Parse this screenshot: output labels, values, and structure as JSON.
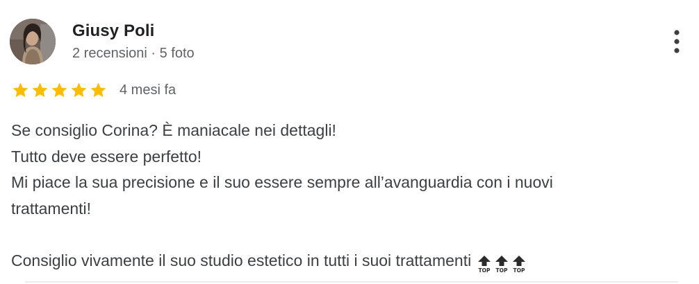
{
  "review": {
    "author": {
      "name": "Giusy Poli",
      "meta": "2 recensioni · 5 foto",
      "avatar_icon": "profile-photo"
    },
    "rating": {
      "stars": 5,
      "max": 5,
      "star_color": "#fbbc04",
      "date": "4 mesi fa"
    },
    "text": {
      "line1": "Se consiglio Corina? È maniacale nei dettagli!",
      "line2": "Tutto deve essere perfetto!",
      "line3": "Mi piace la sua precisione e il suo essere sempre all’avanguardia con i nuovi",
      "line4": "trattamenti!",
      "line5": "Consiglio vivamente il suo studio estetico in tutti i suoi trattamenti",
      "emoji_icons": [
        "top-arrow-emoji",
        "top-arrow-emoji",
        "top-arrow-emoji"
      ]
    },
    "menu_icon": "more-vert-icon"
  }
}
